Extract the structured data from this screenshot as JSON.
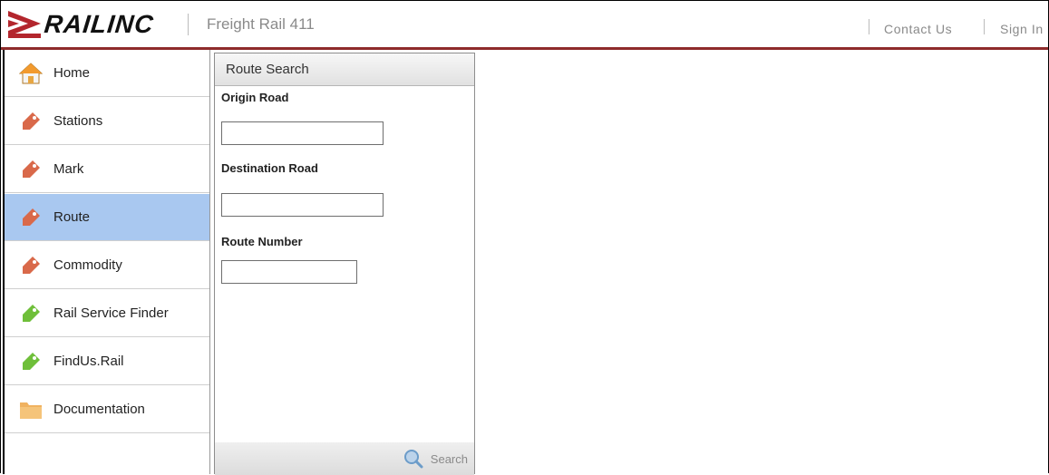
{
  "header": {
    "logo_text": "RAILINC",
    "app_title": "Freight Rail 411",
    "contact_label": "Contact Us",
    "signin_label": "Sign In"
  },
  "sidebar": {
    "items": [
      {
        "label": "Home",
        "icon": "home-icon"
      },
      {
        "label": "Stations",
        "icon": "tag-icon"
      },
      {
        "label": "Mark",
        "icon": "tag-icon"
      },
      {
        "label": "Route",
        "icon": "tag-icon",
        "active": true
      },
      {
        "label": "Commodity",
        "icon": "tag-icon"
      },
      {
        "label": "Rail Service Finder",
        "icon": "tag-icon"
      },
      {
        "label": "FindUs.Rail",
        "icon": "tag-icon"
      },
      {
        "label": "Documentation",
        "icon": "folder-icon"
      }
    ]
  },
  "route_search": {
    "title": "Route Search",
    "origin_label": "Origin Road",
    "origin_value": "",
    "destination_label": "Destination Road",
    "destination_value": "",
    "route_number_label": "Route Number",
    "route_number_value": "",
    "search_label": "Search"
  },
  "colors": {
    "accent_bar": "#8e2b2b",
    "active_nav": "#a9c8f0",
    "tag_red": "#d9694a",
    "tag_green": "#6fbf3a",
    "folder": "#f0b260"
  }
}
